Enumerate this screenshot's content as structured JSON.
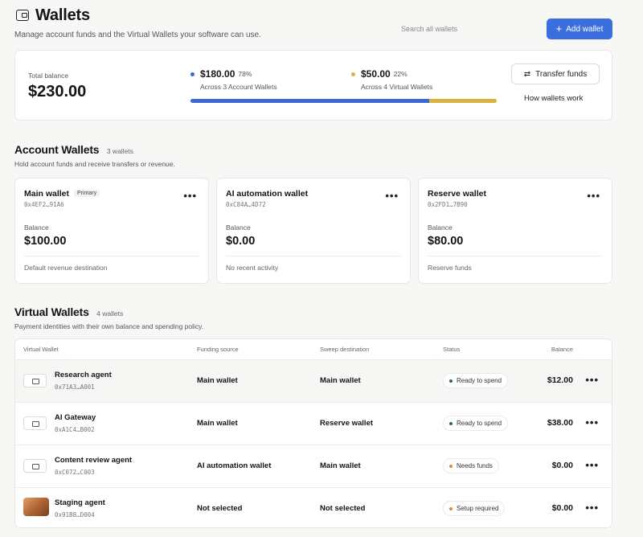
{
  "header": {
    "title": "Wallets",
    "subtitle": "Manage account funds and the Virtual Wallets your software can use.",
    "search_placeholder": "Search all wallets",
    "add_button": "Add wallet"
  },
  "summary": {
    "total_label": "Total balance",
    "total_value": "$230.00",
    "account": {
      "amount": "$180.00",
      "percent": "78%",
      "desc": "Across 3 Account Wallets",
      "color": "#3d66d6",
      "fraction": 0.78
    },
    "virtual": {
      "amount": "$50.00",
      "percent": "22%",
      "desc": "Across 4 Virtual Wallets",
      "color": "#d9b33f",
      "fraction": 0.22
    },
    "transfer_button": "Transfer funds",
    "how_link": "How wallets work"
  },
  "account_section": {
    "title": "Account Wallets",
    "count": "3 wallets",
    "desc": "Hold account funds and receive transfers or revenue.",
    "balance_label": "Balance",
    "wallets": [
      {
        "name": "Main wallet",
        "tag": "Primary",
        "address": "0x4EF2…91A6",
        "balance": "$100.00",
        "footer": "Default revenue destination"
      },
      {
        "name": "AI automation wallet",
        "tag": "",
        "address": "0xC84A…4D72",
        "balance": "$0.00",
        "footer": "No recent activity"
      },
      {
        "name": "Reserve wallet",
        "tag": "",
        "address": "0x2FD1…7B90",
        "balance": "$80.00",
        "footer": "Reserve funds"
      }
    ]
  },
  "virtual_section": {
    "title": "Virtual Wallets",
    "count": "4 wallets",
    "desc": "Payment identities with their own balance and spending policy.",
    "columns": {
      "wallet": "Virtual Wallet",
      "funding": "Funding source",
      "sweep": "Sweep destination",
      "status": "Status",
      "balance": "Balance"
    },
    "rows": [
      {
        "name": "Research agent",
        "address": "0x71A3…A001",
        "funding": "Main wallet",
        "sweep": "Main wallet",
        "status": "Ready to spend",
        "status_color": "#2f6b4f",
        "balance": "$12.00",
        "icon": "wallet-icon"
      },
      {
        "name": "AI Gateway",
        "address": "0xA1C4…B002",
        "funding": "Main wallet",
        "sweep": "Reserve wallet",
        "status": "Ready to spend",
        "status_color": "#2f6b4f",
        "balance": "$38.00",
        "icon": "wallet-icon"
      },
      {
        "name": "Content review agent",
        "address": "0xC072…C003",
        "funding": "AI automation wallet",
        "sweep": "Main wallet",
        "status": "Needs funds",
        "status_color": "#e0892f",
        "balance": "$0.00",
        "icon": "wallet-icon"
      },
      {
        "name": "Staging agent",
        "address": "0x91B8…D004",
        "funding": "Not selected",
        "sweep": "Not selected",
        "status": "Setup required",
        "status_color": "#e0892f",
        "balance": "$0.00",
        "icon": "card-image"
      }
    ]
  }
}
